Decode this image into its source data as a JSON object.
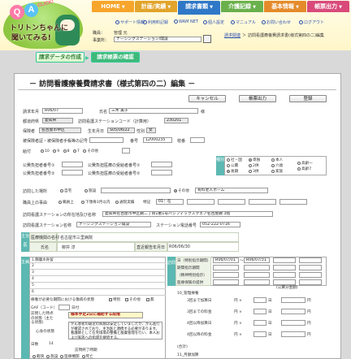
{
  "logo": {
    "q": "Q",
    "a": "A",
    "click": "CLICK!",
    "line1": "トリトンちゃんに",
    "line2": "聞いてみる!"
  },
  "tabs": [
    {
      "label": "HOME",
      "color": "#f7a52b"
    },
    {
      "label": "計画/実績",
      "color": "#e2a42a"
    },
    {
      "label": "請求書類",
      "color": "#2f78c8"
    },
    {
      "label": "介護記録",
      "color": "#6ab04c"
    },
    {
      "label": "基本情報",
      "color": "#e58a2a"
    },
    {
      "label": "帳票出力",
      "color": "#d94a7a"
    }
  ],
  "header_links": [
    "サポート情報",
    "利用料記録",
    "WAM NET",
    "個人設定",
    "マニュアル",
    "お問い合わせ",
    "ログアウト"
  ],
  "header_fields": {
    "office_label": "職員：",
    "office_value": "管理 元",
    "office_label2": "事業所：",
    "office_select": "ナーシングステーション/開設",
    "breadcrumb1": "請求関連",
    "breadcrumb_sep": "＞",
    "breadcrumb2": "訪問看護療養費請求書(様式第四の二)編集"
  },
  "subtabs": [
    "請求データの作成",
    "請求帳票の確認"
  ],
  "page_title": "－ 訪問看護療養費請求書（様式第四の二）編集 －",
  "buttons": {
    "cancel": "キャンセル",
    "output": "帳票出力",
    "register": "登録"
  },
  "form": {
    "claim_month_label": "請求年月",
    "claim_month": "R06/07",
    "name_label": "氏名",
    "name_value": "三木 美子",
    "sama": "様",
    "pref_label": "都道府県",
    "pref_value": "愛知県",
    "station_code_label": "訪問看護ステーションコード（計算用）",
    "station_code": "230201",
    "insurer_label": "保険者",
    "insurer_value": "名古屋市中区",
    "birth_label": "生年月日",
    "birth_value": "S05/06/22",
    "sex_label": "性別",
    "sex_value": "女",
    "insurance_no_label": "被保険者証・被保険者手帳等の記号",
    "number_label": "番号",
    "number_value": "12000235",
    "branch_label": "枝番",
    "benefit_label": "給付",
    "benefit_opts": [
      "10",
      "9",
      "8",
      "7",
      "その他"
    ],
    "public_label1": "公費負担者番号①",
    "public_label2": "公費負担者番号②",
    "public_recip1": "公費負担医療の受給者番号①",
    "public_recip2": "公費負担医療の受給者番号②",
    "type_col": "種別",
    "type_opts": [
      "社・国",
      "公費",
      "後期",
      "退職"
    ],
    "type_opts2": [
      "単独",
      "2併",
      "3併"
    ],
    "type_opts3": [
      "本人",
      "六歳",
      "家族"
    ],
    "type_opts4": [
      "高齢一",
      "高齢7"
    ],
    "visit_place_label": "訪問した場所",
    "visit_place_opts": [
      "自宅",
      "施設",
      "その他"
    ],
    "visit_place_value": "有料老人ホーム",
    "status_label": "職員上の事由",
    "status_opts": [
      "職員上",
      "下顎骨3月以内",
      "通院実績",
      "特記"
    ],
    "status_value": "01：在",
    "station_address_label": "訪問看護ステーションの所在地及び名称",
    "station_address_value": "愛知県名古屋市中区錦二丁目1番1号パシフィックスクエア名古屋錦 3階",
    "station_name_label": "訪問看護ステーション名称",
    "station_name_value": "ナーシングステーション開設",
    "station_tel_label": "ステーション電話番号",
    "station_tel_value": "052-222-0716",
    "doctor_section": "主治医",
    "doctor_inst_label": "医療機関の名称",
    "doctor_inst_value": "名古屋市三里病院",
    "doctor_name_label": "氏名",
    "doctor_name_value": "柳井 淳",
    "instruction_date_label": "直近報告年月日",
    "instruction_date_value": "R06/06/30",
    "disease_section": "主病",
    "disease_rows": [
      "1.胸腹水貯留",
      "2",
      "3",
      "4",
      "5",
      "6"
    ],
    "disease_note_label": "療養が必要な期間における傷病の状態",
    "disease_note_checks": [
      "特別",
      "その他",
      "無"
    ],
    "gaf_label": "GAF（コード）",
    "gaf_day_label": "日",
    "gaf_text": "日付",
    "condition_label": "訪問した時点の状態（主たる状態）",
    "condition_value": "様本手足2日に補助する段階",
    "care_label": "心身の状態",
    "care_value": "がん患者の最近の病態は安定していましたが、がん進行が確認されており、主治医と連携する必要があります。看護師として在宅環境の整備と服薬管理を行い、本人および家族への指導を継続する。",
    "care_count_label": "日数",
    "care_count_value": "14",
    "section_hours": "訪問",
    "period_label1": "日（特別指示期間）",
    "period_label2": "期間指示期間",
    "period_label3": "（精神特別指示）",
    "period_label4": "医療保険の提供",
    "period_from": "R06/07/01",
    "period_to": "R06/07/31",
    "fee_section": "10_管理療養",
    "fee_rows": [
      {
        "label": "3回まで加算日",
        "unit": "円 ×",
        "times": "日",
        "amt": "円"
      },
      {
        "label": "3回までの料金",
        "unit": "円 ×",
        "times": "日",
        "amt": "円"
      },
      {
        "label": "4回以降加算日",
        "unit": "円 ×",
        "times": "日",
        "amt": "円"
      },
      {
        "label": "4回以降の料金",
        "unit": "円 ×",
        "times": "日",
        "amt": "円"
      }
    ],
    "fee_total_label": "(合計)",
    "total_col": "(公費分金額)",
    "end_section": "訪問終了時期",
    "end_label": "終了時刻",
    "end_opts": [
      "軽快",
      "施設",
      "医療機関",
      "死亡"
    ],
    "extra_label": "11_月額加算"
  }
}
